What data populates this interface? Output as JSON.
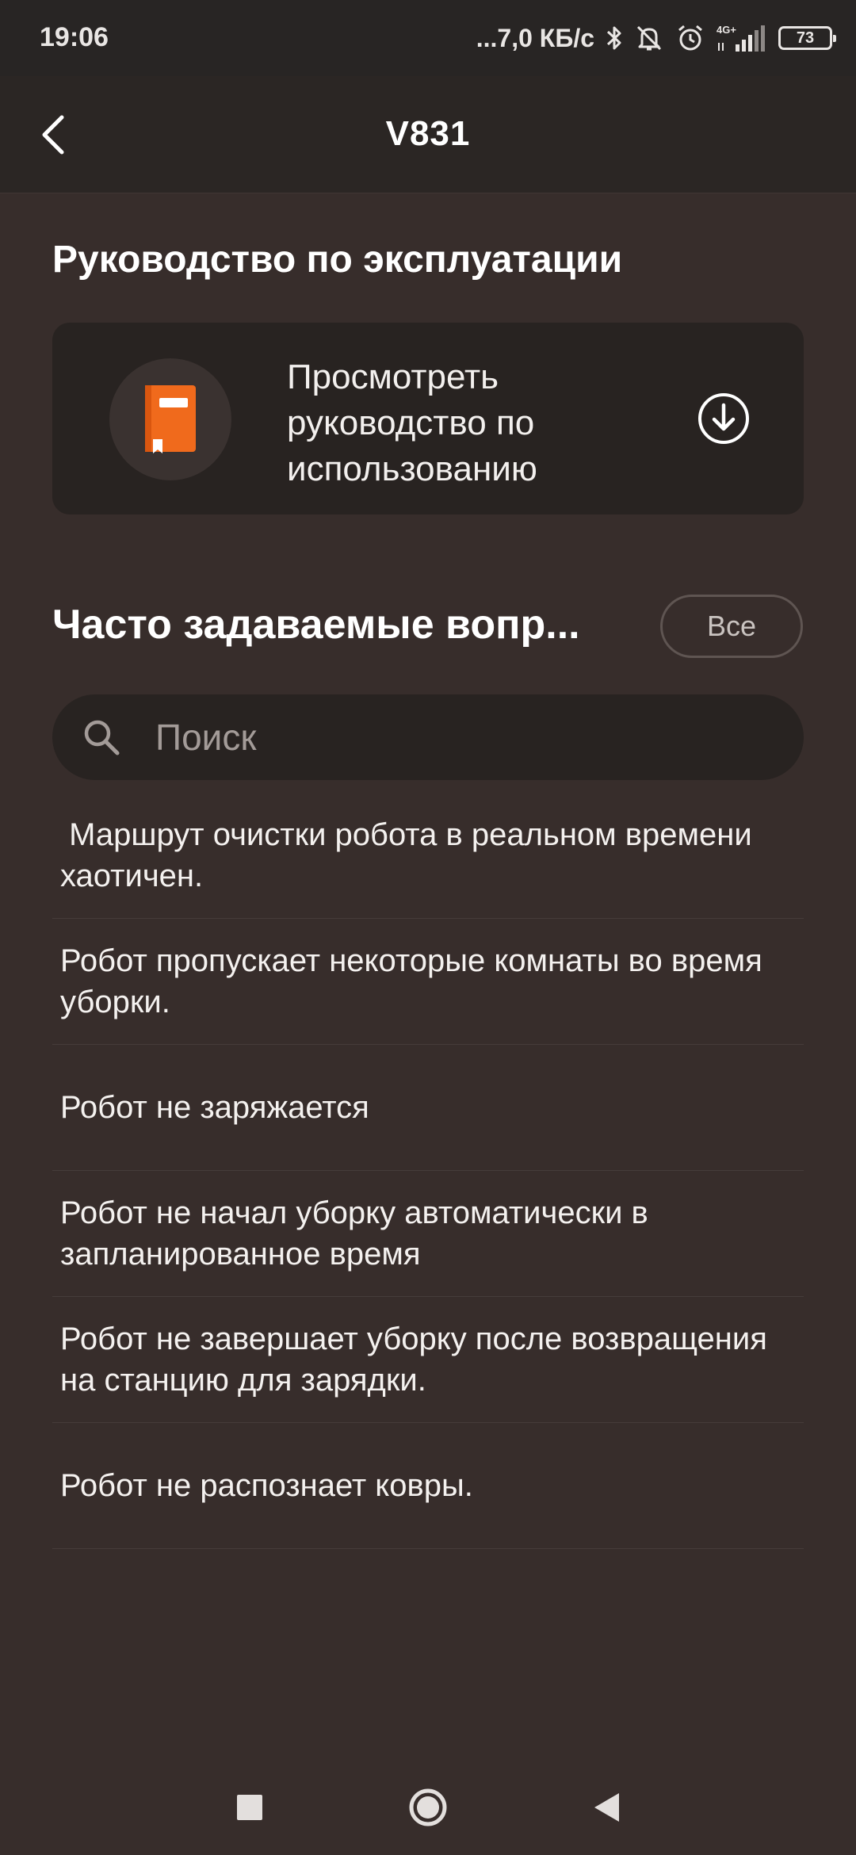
{
  "status_bar": {
    "time": "19:06",
    "network_speed": "...7,0 КБ/с",
    "network_type": "4G+",
    "battery": "73",
    "icons": [
      "bluetooth-icon",
      "muted-bell-icon",
      "alarm-icon",
      "signal-icon",
      "battery-icon"
    ]
  },
  "header": {
    "title": "V831",
    "back_icon": "chevron-left-icon"
  },
  "manual": {
    "section_title": "Руководство по эксплуатации",
    "card_label": "Просмотреть руководство по использованию",
    "book_icon": "book-icon",
    "download_icon": "download-circle-icon",
    "accent_color": "#f06a1c"
  },
  "faq": {
    "section_title": "Часто задаваемые вопр...",
    "all_label": "Все",
    "search_placeholder": "Поиск",
    "items": [
      {
        "text": " Маршрут очистки робота в реальном времени хаотичен."
      },
      {
        "text": "Робот пропускает некоторые комнаты во время уборки."
      },
      {
        "text": "Робот не заряжается"
      },
      {
        "text": "Робот не начал уборку автоматически в запланированное время"
      },
      {
        "text": "Робот не завершает уборку после возвращения на станцию для зарядки."
      },
      {
        "text": "Робот не распознает ковры."
      }
    ]
  },
  "nav_bar": {
    "icons": [
      "recents-square-icon",
      "home-circle-icon",
      "back-triangle-icon"
    ]
  },
  "colors": {
    "background": "#372d2b",
    "header_background": "#2b2624",
    "card_background": "#282321"
  }
}
